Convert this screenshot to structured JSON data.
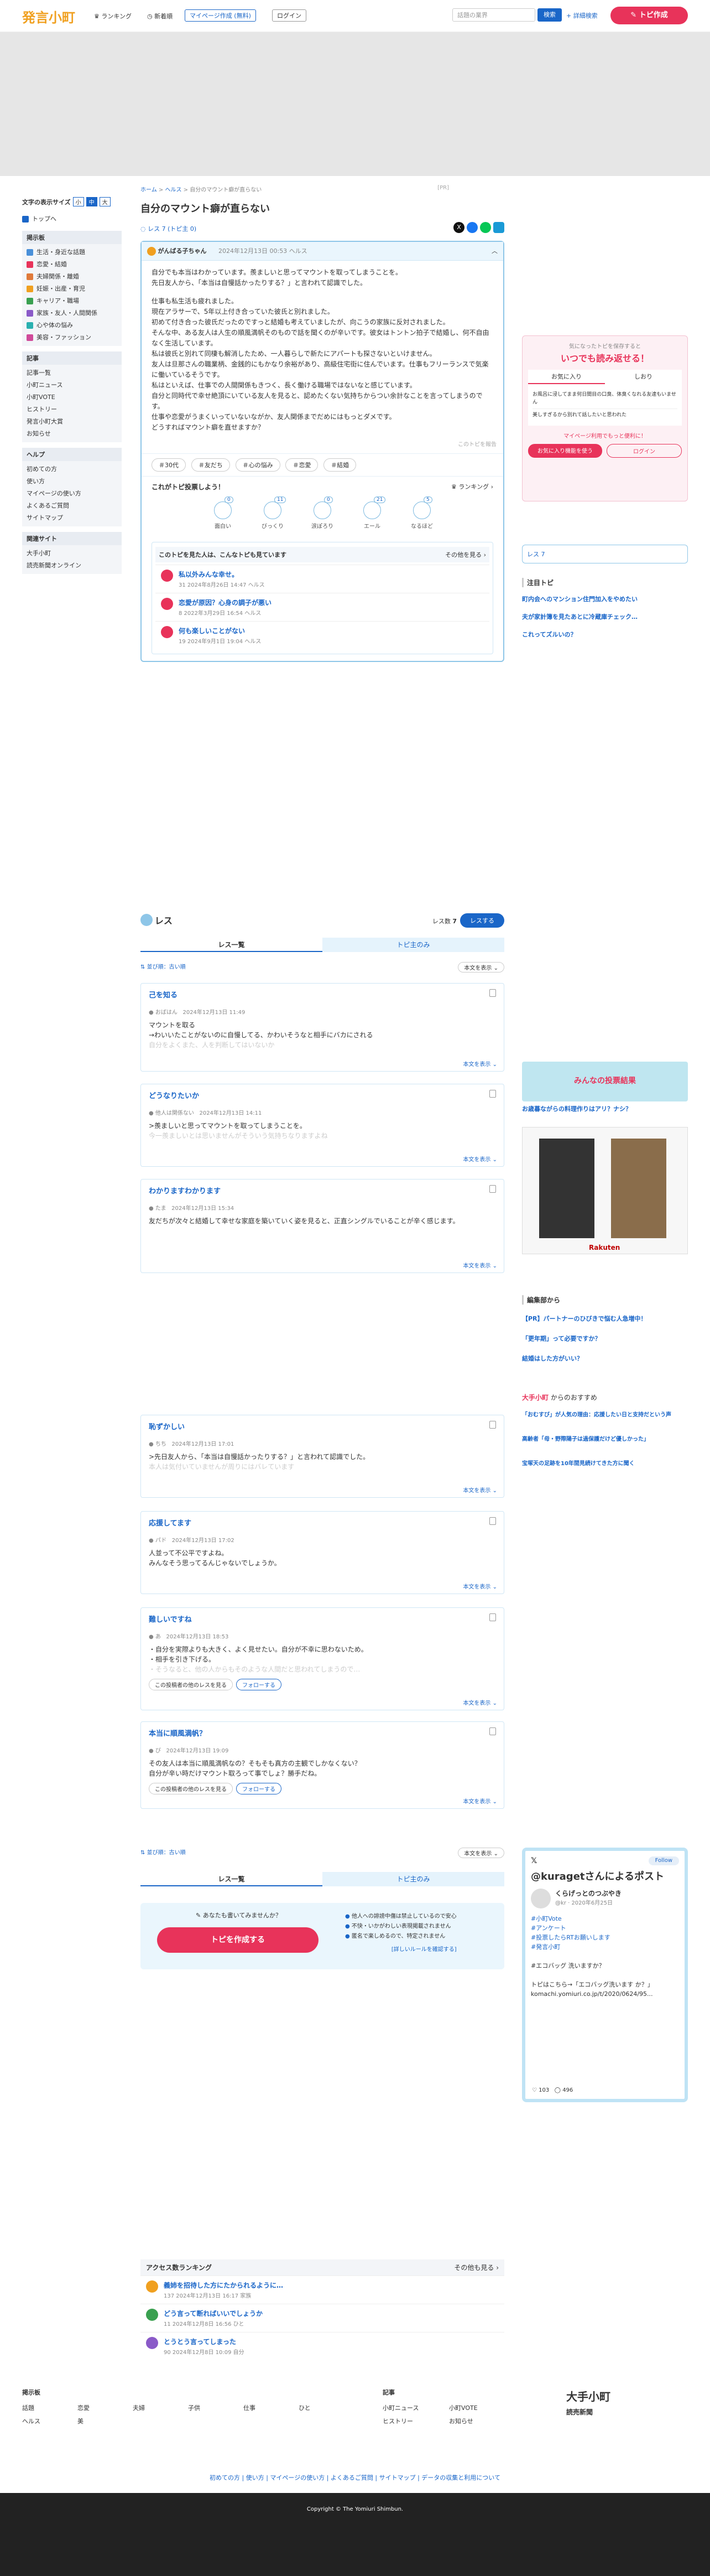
{
  "header": {
    "logo": "発言小町",
    "nav": [
      "ランキング",
      "新着順"
    ],
    "mypage": "マイページ作成 (無料)",
    "login": "ログイン",
    "search_placeholder": "話題の業界",
    "search_btn": "検索",
    "advanced": "詳細検索",
    "create_btn": "トピ作成"
  },
  "left_sidebar": {
    "font_size_label": "文字の表示サイズ",
    "font_sizes": [
      "小",
      "中",
      "大"
    ],
    "top": "トップへ",
    "category_head": "掲示板",
    "categories": [
      {
        "label": "生活・身近な話題",
        "color": "#4a90d9"
      },
      {
        "label": "恋愛・結婚",
        "color": "#e8335a"
      },
      {
        "label": "夫婦関係・離婚",
        "color": "#e07a3a"
      },
      {
        "label": "妊娠・出産・育児",
        "color": "#f0a020"
      },
      {
        "label": "キャリア・職場",
        "color": "#3aa050"
      },
      {
        "label": "家族・友人・人間関係",
        "color": "#8a5ac8"
      },
      {
        "label": "心や体の悩み",
        "color": "#2ab0b0"
      },
      {
        "label": "美容・ファッション",
        "color": "#d04a9a"
      }
    ],
    "kiji_head": "記事",
    "kiji": [
      "記事一覧",
      "小町ニュース",
      "小町VOTE",
      "ヒストリー",
      "発言小町大賞",
      "お知らせ"
    ],
    "help_head": "ヘルプ",
    "help": [
      "初めての方",
      "使い方",
      "マイページの使い方",
      "よくあるご質問",
      "サイトマップ"
    ],
    "related_head": "関連サイト",
    "related": [
      "大手小町",
      "読売新聞オンライン"
    ]
  },
  "breadcrumb": [
    "ホーム",
    "ヘルス",
    "自分のマウント癖が直らない"
  ],
  "pr": "[PR]",
  "topic": {
    "title": "自分のマウント癖が直らない",
    "res_count_label": "レス",
    "res_count": "7",
    "res_sub": "(トピ主 0)",
    "author": "がんばる子ちゃん",
    "date": "2024年12月13日 00:53",
    "category": "ヘルス",
    "body": [
      "自分でも本当はわかっています。羨ましいと思ってマウントを取ってしまうことを。",
      "先日友人から、「本当は自慢話かったりする？」と言われて認識でした。",
      "",
      "仕事も私生活も疲れました。",
      "現在アラサーで、5年以上付き合っていた彼氏と別れました。",
      "初めて付き合った彼氏だったのですっと結婚も考えていましたが、向こうの家族に反対されました。",
      "そんな中、ある友人は人生の順風満帆そのもので話を聞くのが辛いです。彼女はトントン拍子で結婚し、何不自由なく生活しています。",
      "私は彼氏と別れて同棲も解消したため、一人暮らしで新たにアパートも探さないといけません。",
      "友人は旦那さんの職業柄、金銭的にもかなり余裕があり、高級住宅街に住んでいます。仕事もフリーランスで気楽に働いているそうです。",
      "私はといえば、仕事での人間関係もきつく、長く働ける職場ではないなと感じています。",
      "自分と同時代で幸せ絶頂にいている友人を見ると、認めたくない気持ちからつい余計なことを言ってしまうのです。",
      "仕事や恋愛がうまくいっていないながか、友人関係までだめにはもっとダメです。",
      "どうすればマウント癖を直せますか？"
    ],
    "report": "このトピを報告",
    "tags": [
      "＃30代",
      "＃友だち",
      "＃心の悩み",
      "＃恋愛",
      "＃結婚"
    ],
    "vote_title": "これがトピ投票しよう！",
    "ranking": "ランキング",
    "reactions": [
      {
        "label": "面白い",
        "count": "0"
      },
      {
        "label": "びっくり",
        "count": "11"
      },
      {
        "label": "涙ぽろり",
        "count": "0"
      },
      {
        "label": "エール",
        "count": "21"
      },
      {
        "label": "なるほど",
        "count": "5"
      }
    ]
  },
  "related_topics": {
    "title": "このトピを見た人は、こんなトピも見ています",
    "more": "その他を見る",
    "items": [
      {
        "title": "私以外みんな幸せ。",
        "meta": "31 2024年8月26日 14:47 ヘルス"
      },
      {
        "title": "恋愛が原因？心身の調子が悪い",
        "meta": "8 2022年3月29日 16:54 ヘルス"
      },
      {
        "title": "何も楽しいことがない",
        "meta": "19 2024年9月1日 19:04 ヘルス"
      }
    ]
  },
  "res_section": {
    "title": "レス",
    "count_label": "レス数",
    "count": "7",
    "post_btn": "レスする",
    "tab_list": "レス一覧",
    "tab_topi": "トピ主のみ",
    "sort_order": "並び順：古い順",
    "sort_select": "本文を表示"
  },
  "responses": [
    {
      "title": "己を知る",
      "author": "おばはん",
      "date": "2024年12月13日 11:49",
      "body": [
        "マウントを取る",
        "→わいいたことがないのに自慢してる、かわいそうなと相手にバカにされる"
      ],
      "fade": "自分をよくまた、人を判断してはいないか",
      "more": "本文を表示",
      "follow": false
    },
    {
      "title": "どうなりたいか",
      "author": "他人は関係ない",
      "date": "2024年12月13日 14:11",
      "body": [
        ">羨ましいと思ってマウントを取ってしまうことを。"
      ],
      "fade": "今一羨ましいとは思いませんがそういう気持ちなりますよね",
      "more": "本文を表示",
      "follow": false
    },
    {
      "title": "わかりますわかります",
      "author": "たま",
      "date": "2024年12月13日 15:34",
      "body": [
        "友だちが次々と結婚して幸せな家庭を築いていく姿を見ると、正直シングルでいることが辛く感じます。"
      ],
      "fade": "",
      "more": "本文を表示",
      "follow": false
    },
    {
      "title": "恥ずかしい",
      "author": "ちち",
      "date": "2024年12月13日 17:01",
      "body": [
        ">先日友人から、「本当は自慢話かったりする？」と言われて認識でした。"
      ],
      "fade": "本人は気付いていませんが周りにはバレています",
      "more": "本文を表示",
      "follow": false
    },
    {
      "title": "応援してます",
      "author": "パド",
      "date": "2024年12月13日 17:02",
      "body": [
        "人並って不公平ですよね。",
        "みんなそう思ってるんじゃないでしょうか。"
      ],
      "fade": "",
      "more": "本文を表示",
      "follow": false
    },
    {
      "title": "難しいですね",
      "author": "あ",
      "date": "2024年12月13日 18:53",
      "body": [
        "・自分を実際よりも大きく、よく見せたい。自分が不幸に思わないため。",
        "・相手を引き下げる。"
      ],
      "fade": "・そうなると、他の人からもそのような人間だと思われてしまうので…",
      "more": "本文を表示",
      "follow": true
    },
    {
      "title": "本当に順風満帆？",
      "author": "ぴ",
      "date": "2024年12月13日 19:09",
      "body": [
        "その友人は本当に順風満帆なの？そもそも真方の主観でしかなくない？",
        "自分が辛い時だけマウント取ろって事でしょ？勝手だね。"
      ],
      "fade": "",
      "more": "本文を表示",
      "follow": true
    }
  ],
  "reply_btn": "この投稿者の他のレスを見る",
  "follow_btn": "フォローする",
  "bottom_cta": {
    "question": "あなたも書いてみませんか？",
    "btn": "トピを作成する",
    "rules": [
      "他人への誹謗中傷は禁止しているので安心",
      "不快・いかがわしい表現掲載されません",
      "匿名で楽しめるので、特定されません"
    ],
    "link": "[詳しいルールを確認する]"
  },
  "access_ranking": {
    "title": "アクセス数ランキング",
    "more": "その他も見る",
    "items": [
      {
        "title": "義姉を招待した方にたかられるように…",
        "meta": "137 2024年12月13日 16:17 家族"
      },
      {
        "title": "どう言って断ればいいでしょうか",
        "meta": "11 2024年12月8日 16:56 ひと"
      },
      {
        "title": "とうとう言ってしまった",
        "meta": "90 2024年12月8日 10:09 自分"
      }
    ]
  },
  "right_sidebar": {
    "app_promo": "いつでも読み返せる！",
    "app_sub": "気になったトピを保存すると",
    "app_tabs": [
      "お気に入り",
      "しおり"
    ],
    "app_items": [
      "お風呂に浸してまま何日間目の口臭、体臭くなれる友達もいません",
      "美しすぎるから別れて話したいと思われた"
    ],
    "app_cta": "マイページ利用でもっと便利に！",
    "app_save": "お気に入り機能を使う",
    "app_login": "ログイン",
    "chumoku_head": "注目トピ",
    "chumoku": [
      "町内会へのマンション住門加入をやめたい",
      "夫が家計簿を見たあとに冷蔵庫チェック…",
      "これってズルいの？"
    ],
    "vote_banner": "みんなの投票結果",
    "vote_q": "お歳暮ながらの料理作りはアリ？ナシ？",
    "ad_brand": "Rakuten",
    "editorial_head": "編集部から",
    "editorial": [
      "【PR】パートナーのひびきで悩む人急増中！",
      "「更年期」って必要ですか？",
      "結婚はした方がいい？"
    ],
    "otemachi_head": "大手小町",
    "otemachi_sub": "からのおすすめ",
    "otemachi": [
      "「おむすび」が人気の理由：応援したい日と支持だという声",
      "高齢者「母・野際陽子は過保護だけど優しかった」",
      "宝塚天の足跡を10年間見続けてきた方に聞く"
    ],
    "x_card": {
      "follow": "Follow",
      "title": "@kuragetさんによるポスト",
      "name": "くらげっとのつぶやき",
      "handle": "@kr · 2020年6月25日",
      "lines": [
        "#小町Vote",
        "#アンケート",
        "#投票したらRTお願いします",
        "#発言小町",
        "",
        "#エコバッグ 洗いますか？",
        "",
        "トピはこちら→「エコバッグ洗います か？」komachi.yomiuri.co.jp/t/2020/0624/95..."
      ],
      "likes": "103",
      "replies": "496"
    }
  },
  "footer": {
    "board_head": "掲示板",
    "boards": [
      "話題",
      "恋愛",
      "夫婦",
      "子供",
      "仕事",
      "ひと",
      "ヘルス",
      "美"
    ],
    "kiji_head": "記事",
    "kiji": [
      "小町ニュース",
      "小町VOTE",
      "ヒストリー",
      "お知らせ"
    ],
    "brand": "大手小町",
    "brand_sub": "読売新聞",
    "links": "初めての方 | 使い方 | マイページの使い方 | よくあるご質問 | サイトマップ | データの収集と利用について",
    "copyright": "Copyright © The Yomiuri Shimbun."
  }
}
